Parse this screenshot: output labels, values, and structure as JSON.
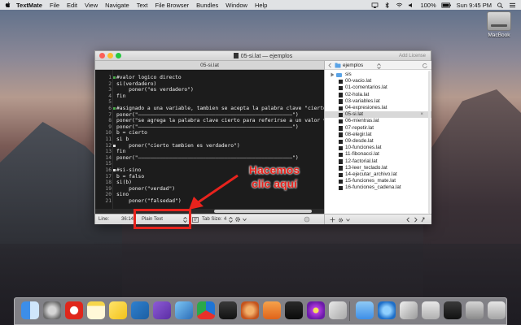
{
  "menubar": {
    "app_name": "TextMate",
    "items": [
      "File",
      "Edit",
      "View",
      "Navigate",
      "Text",
      "File Browser",
      "Bundles",
      "Window",
      "Help"
    ],
    "battery": "100%",
    "clock": "Sun 9:45 PM"
  },
  "desktop": {
    "disk_label": "MacBook"
  },
  "window": {
    "title": "05-si.lat — ejemplos",
    "add_license": "Add License",
    "tab_label": "05-si.lat"
  },
  "editor": {
    "lines": [
      {
        "num": "1",
        "code": "#valor logico directo"
      },
      {
        "num": "2",
        "code": "si(verdadero)"
      },
      {
        "num": "3",
        "code": "    poner(\"es verdadero\")"
      },
      {
        "num": "4",
        "code": "fin"
      },
      {
        "num": "5",
        "code": ""
      },
      {
        "num": "6",
        "code": "#asignado a una variable, tambien se acepta la palabra clave \"cierto\""
      },
      {
        "num": "7",
        "code": "poner(\"——————————————————————————————————————————————————\")"
      },
      {
        "num": "8",
        "code": "poner(\"se agrega la palabra clave cierto para referirse a un valor ver"
      },
      {
        "num": "9",
        "code": "poner(\"——————————————————————————————————————————————————\")"
      },
      {
        "num": "10",
        "code": "b = cierto"
      },
      {
        "num": "11",
        "code": "si b"
      },
      {
        "num": "12",
        "code": "    poner(\"cierto tambien es verdadero\")"
      },
      {
        "num": "13",
        "code": "fin"
      },
      {
        "num": "14",
        "code": "poner(\"——————————————————————————————————————————————————\")"
      },
      {
        "num": "15",
        "code": ""
      },
      {
        "num": "16",
        "code": "#si-sino"
      },
      {
        "num": "17",
        "code": "b = falso"
      },
      {
        "num": "18",
        "code": "si(b)"
      },
      {
        "num": "19",
        "code": "    poner(\"verdad\")"
      },
      {
        "num": "20",
        "code": "sino"
      },
      {
        "num": "21",
        "code": "    poner(\"falsedad\")"
      }
    ]
  },
  "statusbar": {
    "line_label": "Line:",
    "line_value": "36:14",
    "grammar": "Plain Text",
    "tab_size_label": "Tab Size:",
    "tab_size_value": "4"
  },
  "drawer": {
    "root": "ejemplos",
    "items": [
      {
        "label": "sis",
        "type": "folder"
      },
      {
        "label": "00-vacio.lat",
        "type": "file"
      },
      {
        "label": "01-comentarios.lat",
        "type": "file"
      },
      {
        "label": "02-hola.lat",
        "type": "file"
      },
      {
        "label": "03-variables.lat",
        "type": "file"
      },
      {
        "label": "04-expresiones.lat",
        "type": "file"
      },
      {
        "label": "05-si.lat",
        "type": "file",
        "selected": true
      },
      {
        "label": "06-mientras.lat",
        "type": "file"
      },
      {
        "label": "07-repetir.lat",
        "type": "file"
      },
      {
        "label": "08-elegir.lat",
        "type": "file"
      },
      {
        "label": "09-desde.lat",
        "type": "file"
      },
      {
        "label": "10-funciones.lat",
        "type": "file"
      },
      {
        "label": "11-fibonacci.lat",
        "type": "file"
      },
      {
        "label": "12-factorial.lat",
        "type": "file"
      },
      {
        "label": "13-leer_teclado.lat",
        "type": "file"
      },
      {
        "label": "14-ejecutar_archivo.lat",
        "type": "file"
      },
      {
        "label": "15-funciones_mate.lat",
        "type": "file"
      },
      {
        "label": "16-funciones_cadena.lat",
        "type": "file"
      }
    ]
  },
  "annotation": {
    "line1": "Hacemos",
    "line2": "clic aquí",
    "color": "#e8231d"
  },
  "dock": {
    "icons": [
      "finder-icon",
      "launchpad-icon",
      "opera-icon",
      "notes-icon",
      "stickies-icon",
      "visual-studio-code-icon",
      "visual-studio-icon",
      "xcode-icon",
      "latino-icon",
      "terminal-icon",
      "money-icon",
      "ibooks-icon",
      "activity-monitor-icon",
      "flower-icon",
      "preview-icon",
      "folder-icon",
      "network-icon",
      "gpg-icon",
      "screen-icon",
      "terminal-window-icon",
      "display-icon",
      "trash-icon"
    ]
  }
}
